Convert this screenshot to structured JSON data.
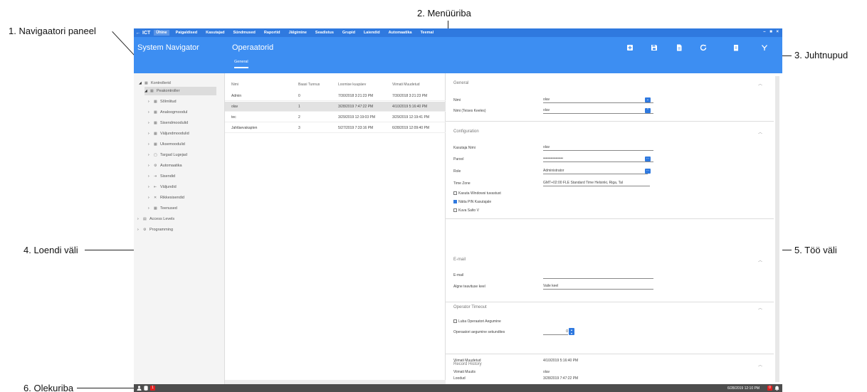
{
  "annotations": {
    "nav_panel": "1.  Navigaatori paneel",
    "menubar": "2. Menüüriba",
    "toolbar": "3. Juhtnupud",
    "list_field": "4. Loendi väli",
    "work_field": "5. Töö väli",
    "status_bar": "6. Olekuriba"
  },
  "menubar": {
    "back": "←",
    "logo": "ICT",
    "items": [
      "Ühine",
      "Paigaldised",
      "Kasutajad",
      "Sündmused",
      "Raportid",
      "Jälgimine",
      "Seadistus",
      "Grupid",
      "Laiendid",
      "Automaatika",
      "Teemal"
    ],
    "active_index": 0,
    "window_controls": "– ■ ×"
  },
  "header": {
    "navigator_title": "System Navigator",
    "page_title": "Operaatorid",
    "tab": "General"
  },
  "toolbar_icons": [
    "add-icon",
    "save-icon",
    "document-icon",
    "refresh-icon",
    "delete-icon",
    "filter-icon"
  ],
  "navigator": {
    "items": [
      {
        "label": "Kontrollerid",
        "toggle": "◢",
        "icon": "▦",
        "level": 0
      },
      {
        "label": "Peakontroller",
        "toggle": "◢",
        "icon": "▦",
        "level": 1,
        "selected": true
      },
      {
        "label": "Sõlmlitud",
        "toggle": "›",
        "icon": "▦",
        "level": 2
      },
      {
        "label": "Analoogmoodul",
        "toggle": "›",
        "icon": "▦",
        "level": 2
      },
      {
        "label": "Sisendmoodulid",
        "toggle": "›",
        "icon": "▦",
        "level": 2
      },
      {
        "label": "Väljundmoodulid",
        "toggle": "›",
        "icon": "▦",
        "level": 2
      },
      {
        "label": "Uksemoodulid",
        "toggle": "›",
        "icon": "▦",
        "level": 2
      },
      {
        "label": "Targad Lugejad",
        "toggle": "›",
        "icon": "▢",
        "level": 2
      },
      {
        "label": "Automaatika",
        "toggle": "›",
        "icon": "⚙",
        "level": 2
      },
      {
        "label": "Sisendid",
        "toggle": "›",
        "icon": "⇥",
        "level": 2
      },
      {
        "label": "Väljundid",
        "toggle": "›",
        "icon": "⇤",
        "level": 2
      },
      {
        "label": "Rikkesisendid",
        "toggle": "›",
        "icon": "✕",
        "level": 2
      },
      {
        "label": "Teenused",
        "toggle": "›",
        "icon": "▦",
        "level": 2
      },
      {
        "label": "Access Levels",
        "toggle": "›",
        "icon": "▤",
        "level": 0
      },
      {
        "label": "Programming",
        "toggle": "›",
        "icon": "⚙",
        "level": 0
      }
    ]
  },
  "list": {
    "columns": [
      "Nimi",
      "Baasi Tunnus",
      "Loomise kuupäev",
      "Viimati Muudetud"
    ],
    "rows": [
      {
        "cells": [
          "Admin",
          "0",
          "7/30/2018 3:21:23 PM",
          "7/30/2018 3:21:23 PM"
        ],
        "selected": false
      },
      {
        "cells": [
          "olav",
          "1",
          "3/28/2019 7:47:22 PM",
          "4/10/2019 5:16:40 PM"
        ],
        "selected": true
      },
      {
        "cells": [
          "tec",
          "2",
          "3/29/2019 12:19:03 PM",
          "3/29/2019 12:19:41 PM"
        ],
        "selected": false
      },
      {
        "cells": [
          "Jahtlaevakapten",
          "3",
          "5/27/2019 7:33:16 PM",
          "6/28/2019 12:09:40 PM"
        ],
        "selected": false
      }
    ]
  },
  "work": {
    "general": {
      "title": "General",
      "name_label": "Nimi",
      "name_value": "olav",
      "name_other_label": "Nimi (Teises Keeles)",
      "name_other_value": "olav"
    },
    "configuration": {
      "title": "Configuration",
      "username_label": "Kasutaja Nimi",
      "username_value": "olav",
      "password_label": "Parool",
      "password_value": "••••••••••••••••",
      "role_label": "Role",
      "role_value": "Administrator",
      "timezone_label": "Time Zone",
      "timezone_value": "GMT+02:00 FLE Standard Time Helsinki, Riga, Tal",
      "windows_auth_label": "Kasuta Windowsi tuvastust",
      "show_pin_label": "Näita PIN Kasutajale",
      "salto_label": "Kuva Salto V",
      "windows_auth_checked": false,
      "show_pin_checked": true,
      "salto_checked": false
    },
    "email": {
      "title": "E-mail",
      "email_label": "E-mail",
      "email_value": "",
      "lang_label": "Algne teavituse keel",
      "lang_value": "Vaile keel"
    },
    "timeout": {
      "title": "Operator Timeout",
      "allow_label": "Luba Operaatori Aegumine",
      "seconds_label": "Operaatori aegumine sekundites",
      "seconds_value": "0",
      "allow_checked": false
    },
    "history": {
      "title": "Record History",
      "created_label": "Loodud",
      "created_value": "3/28/2019 7:47:22 PM",
      "modified_label": "Viimati Muudetud",
      "modified_value": "4/10/2019 5:16:40 PM",
      "modifier_label": "Viimati Muutis",
      "modifier_value": "olav"
    }
  },
  "status": {
    "badge_left": "1",
    "time": "6/28/2019 12:10 PM",
    "badge_right": "0"
  },
  "colors": {
    "menubar": "#2f79df",
    "header": "#3d8ef2",
    "status_bar": "#4d4d4d",
    "alert": "#e02020"
  }
}
